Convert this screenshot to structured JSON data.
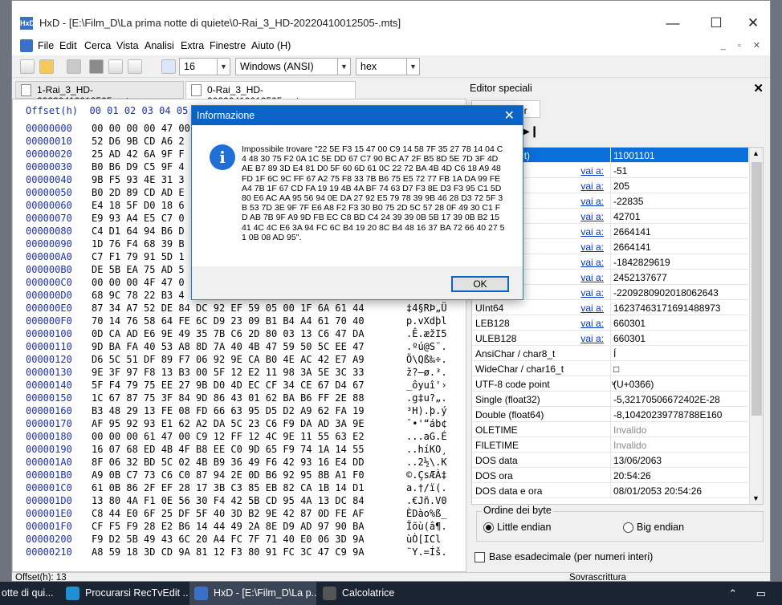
{
  "window": {
    "title": "HxD - [E:\\Film_D\\La prima notte di quiete\\0-Rai_3_HD-20220410012505-.mts]",
    "app_icon": "HxD",
    "minimize_icon": "minimize-icon",
    "maximize_icon": "maximize-icon",
    "close_icon": "close-icon"
  },
  "menu": [
    "File",
    "Edit",
    "Cerca",
    "Vista",
    "Analisi",
    "Extra",
    "Finestre",
    "Aiuto (H)"
  ],
  "toolbar": {
    "bytes_per_row": "16",
    "charset": "Windows (ANSI)",
    "display": "hex"
  },
  "tabs": [
    {
      "label": "1-Rai_3_HD-20220410012505-.mts"
    },
    {
      "label": "0-Rai_3_HD-20220410012505-.mts"
    }
  ],
  "hex": {
    "header": "Offset(h)  00 01 02 03 04 05 06 07 08 09 0A 0B 0C 0D 0E 0F",
    "rows": [
      {
        "off": "00000000",
        "bytes": "00 00 00 00 47 00",
        "ascii": ""
      },
      {
        "off": "00000010",
        "bytes": "52 D6 9B CD A6 2",
        "ascii": ""
      },
      {
        "off": "00000020",
        "bytes": "25 AD 42 6A 9F F",
        "ascii": ""
      },
      {
        "off": "00000030",
        "bytes": "B0 B6 D9 C5 9F 4",
        "ascii": ""
      },
      {
        "off": "00000040",
        "bytes": "9B F5 93 4E 31 3",
        "ascii": ""
      },
      {
        "off": "00000050",
        "bytes": "B0 2D 89 CD AD E",
        "ascii": ""
      },
      {
        "off": "00000060",
        "bytes": "E4 18 5F D0 18 6",
        "ascii": ""
      },
      {
        "off": "00000070",
        "bytes": "E9 93 A4 E5 C7 0",
        "ascii": ""
      },
      {
        "off": "00000080",
        "bytes": "C4 D1 64 94 B6 D",
        "ascii": ""
      },
      {
        "off": "00000090",
        "bytes": "1D 76 F4 68 39 B",
        "ascii": ""
      },
      {
        "off": "000000A0",
        "bytes": "C7 F1 79 91 5D 1",
        "ascii": ""
      },
      {
        "off": "000000B0",
        "bytes": "DE 5B EA 75 AD 5",
        "ascii": ""
      },
      {
        "off": "000000C0",
        "bytes": "00 00 00 4F 47 0",
        "ascii": ""
      },
      {
        "off": "000000D0",
        "bytes": "68 9C 78 22 B3 4",
        "ascii": ""
      },
      {
        "off": "000000E0",
        "bytes": "87 34 A7 52 DE 84 DC 92 EF 59 05 00 1F 6A 61 44",
        "ascii": "‡4§RÞ„Ü"
      },
      {
        "off": "000000F0",
        "bytes": "70 14 76 58 64 FE 6C D9 23 09 B1 B4 A4 61 70 40",
        "ascii": "p.vXdþl"
      },
      {
        "off": "00000100",
        "bytes": "0D CA AD E6 9E 49 35 7B C6 2D 80 03 13 C6 47 DA",
        "ascii": ".Ê.æžI5"
      },
      {
        "off": "00000110",
        "bytes": "9D BA FA 40 53 A8 8D 7A 40 4B 47 59 50 5C EE 47",
        "ascii": ".ºú@S¨."
      },
      {
        "off": "00000120",
        "bytes": "D6 5C 51 DF 89 F7 06 92 9E CA B0 4E AC 42 E7 A9",
        "ascii": "Ö\\Qß‰÷."
      },
      {
        "off": "00000130",
        "bytes": "9E 3F 97 F8 13 B3 00 5F 12 E2 11 98 3A 5E 3C 33",
        "ascii": "ž?—ø.³."
      },
      {
        "off": "00000140",
        "bytes": "5F F4 79 75 EE 27 9B D0 4D EC CF 34 CE 67 D4 67",
        "ascii": "_ôyuî'›"
      },
      {
        "off": "00000150",
        "bytes": "1C 67 87 75 3F 84 9D 86 43 01 62 BA B6 FF 2E 88",
        "ascii": ".g‡u?„."
      },
      {
        "off": "00000160",
        "bytes": "B3 48 29 13 FE 08 FD 66 63 95 D5 D2 A9 62 FA 19",
        "ascii": "³H).þ.ý"
      },
      {
        "off": "00000170",
        "bytes": "AF 95 92 93 E1 62 A2 DA 5C 23 C6 F9 DA AD 3A 9E",
        "ascii": "¯•'“áb¢"
      },
      {
        "off": "00000180",
        "bytes": "00 00 00 61 47 00 C9 12 FF 12 4C 9E 11 55 63 E2",
        "ascii": "...aG.É"
      },
      {
        "off": "00000190",
        "bytes": "16 07 68 ED 4B 4F B8 EE C0 9D 65 F9 74 1A 14 55",
        "ascii": "..híKO¸"
      },
      {
        "off": "000001A0",
        "bytes": "8F 06 32 BD 5C 02 4B B9 36 49 F6 42 93 16 E4 DD",
        "ascii": "..2½\\.K"
      },
      {
        "off": "000001B0",
        "bytes": "A9 0B C7 73 C6 C0 87 94 2E 0D B6 92 95 8B A1 F0",
        "ascii": "©.ÇsÆÀ‡"
      },
      {
        "off": "000001C0",
        "bytes": "61 0B 86 2F EF 28 17 3B C3 85 EB 82 CA 1B 14 D1",
        "ascii": "a.†/ï(."
      },
      {
        "off": "000001D0",
        "bytes": "13 80 4A F1 0E 56 30 F4 42 5B CD 95 4A 13 DC 84",
        "ascii": ".€Jñ.V0"
      },
      {
        "off": "000001E0",
        "bytes": "C8 44 E0 6F 25 DF 5F 40 3D B2 9E 42 87 0D FE AF",
        "ascii": "ÈDào%ß_"
      },
      {
        "off": "000001F0",
        "bytes": "CF F5 F9 28 E2 B6 14 44 49 2A 8E D9 AD 97 90 BA",
        "ascii": "Ïõù(â¶."
      },
      {
        "off": "00000200",
        "bytes": "F9 D2 5B 49 43 6C 20 A4 FC 7F 71 40 E0 06 3D 9A",
        "ascii": "ùÒ[ICl "
      },
      {
        "off": "00000210",
        "bytes": "A8 59 18 3D CD 9A 81 12 F3 80 91 FC 3C 47 C9 9A",
        "ascii": "¨Y.=Íš."
      }
    ]
  },
  "status": {
    "offset": "Offset(h): 13",
    "mode": "Sovrascrittura"
  },
  "special": {
    "title": "Editor speciali",
    "tab": "itor",
    "rows": [
      {
        "name": "Binary (8 bit)",
        "link": "",
        "value": "11001101",
        "selected": true
      },
      {
        "name": "Int8",
        "link": "vai a:",
        "value": "-51"
      },
      {
        "name": "UInt8",
        "link": "vai a:",
        "value": "205"
      },
      {
        "name": "Int16",
        "link": "vai a:",
        "value": "-22835"
      },
      {
        "name": "UInt16",
        "link": "vai a:",
        "value": "42701"
      },
      {
        "name": "Int24",
        "link": "vai a:",
        "value": "2664141"
      },
      {
        "name": "UInt24",
        "link": "vai a:",
        "value": "2664141"
      },
      {
        "name": "Int32",
        "link": "vai a:",
        "value": "-1842829619"
      },
      {
        "name": "UInt32",
        "link": "vai a:",
        "value": "2452137677"
      },
      {
        "name": "Int64",
        "link": "vai a:",
        "value": "-2209280902018062643"
      },
      {
        "name": "UInt64",
        "link": "vai a:",
        "value": "16237463171691488973"
      },
      {
        "name": "LEB128",
        "link": "vai a:",
        "value": "660301"
      },
      {
        "name": "ULEB128",
        "link": "vai a:",
        "value": "660301"
      },
      {
        "name": "AnsiChar / char8_t",
        "link": "",
        "value": "Í"
      },
      {
        "name": "WideChar / char16_t",
        "link": "",
        "value": "□"
      },
      {
        "name": "UTF-8 code point",
        "link": "",
        "value": "ͮ(U+0366)"
      },
      {
        "name": "Single (float32)",
        "link": "",
        "value": "-5,32170506672402E-28"
      },
      {
        "name": "Double (float64)",
        "link": "",
        "value": "-8,10420239778788E160"
      },
      {
        "name": "OLETIME",
        "link": "",
        "value": "Invalido",
        "gray": true
      },
      {
        "name": "FILETIME",
        "link": "",
        "value": "Invalido",
        "gray": true
      },
      {
        "name": "DOS data",
        "link": "",
        "value": "13/06/2063"
      },
      {
        "name": "DOS ora",
        "link": "",
        "value": "20:54:26"
      },
      {
        "name": "DOS data e ora",
        "link": "",
        "value": "08/01/2053 20:54:26"
      }
    ],
    "byte_order_title": "Ordine dei byte",
    "little_endian": "Little endian",
    "big_endian": "Big endian",
    "hex_base": "Base esadecimale (per numeri interi)"
  },
  "dialog": {
    "title": "Informazione",
    "icon": "info-icon",
    "message": "Impossibile trovare \"22 5E F3 15 47 00 C9 14 58 7F 35 27 78 14 04 C4 48 30 75 F2 0A 1C 5E DD 67 C7 90 BC A7 2F B5 8D 5E 7D 3F 4D AE B7 89 3D E4 81 D0 5F 60 6D 61 0C 22 72 BA 4B 4D C6 18 A9 48 FD 1F 6C 9C FF 67 A2 75 F8 33 7B B6 75 E5 72 77 FB 1A DA 99 FE A4 7B 1F 67 CD FA 19 19 4B 4A BF 74 63 D7 F3 8E D3 F3 95 C1 5D 80 E6 AC AA 95 56 94 0E DA 27 92 E5 79 78 39 9B 46 28 D3 72 5F 3B 53 7D 3E 9F 7F E6 A8 F2 F3 30 B0 75 2D 5C 57 28 0F 49 30 C1 FD AB 7B 9F A9 9D FB EC C8 BD C4 24 39 39 0B 5B 17 39 0B B2 15 41 4C 4C E6 3A 94 FC 6C B4 19 20 8C B4 48 16 37 BA 72 66 40 27 51 0B 08 AD 95\".",
    "ok": "OK"
  },
  "taskbar": [
    {
      "label": "otte di qui...",
      "color": "#d9a233"
    },
    {
      "label": "Procurarsi RecTvEdit ...",
      "color": "#1f8fd6"
    },
    {
      "label": "HxD - [E:\\Film_D\\La p...",
      "color": "#3a70c8",
      "active": true
    },
    {
      "label": "Calcolatrice",
      "color": "#555"
    }
  ]
}
